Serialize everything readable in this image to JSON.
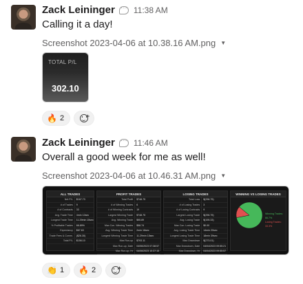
{
  "messages": [
    {
      "author": "Zack Leininger",
      "time": "11:38 AM",
      "text": "Calling it a day!",
      "file_name": "Screenshot 2023-04-06 at 10.38.16 AM.png",
      "thumbnail": {
        "label": "TOTAL P/L",
        "value": "302.10"
      },
      "reactions": [
        {
          "emoji": "🔥",
          "emoji_name": "fire-icon",
          "count": "2"
        }
      ]
    },
    {
      "author": "Zack Leininger",
      "time": "11:46 AM",
      "text": "Overall a good week for me as well!",
      "file_name": "Screenshot 2023-04-06 at 10.46.31 AM.png",
      "dashboard": {
        "panels": [
          {
            "title": "ALL TRADES",
            "rows": [
              [
                "Net P/L",
                "$167.73"
              ],
              [
                "# of Trades",
                "9"
              ],
              [
                "# of Contracts",
                "33"
              ],
              [
                "Avg. Trade Time",
                "4min 12sec"
              ],
              [
                "Longest Trade Time",
                "11.29min 15sec"
              ],
              [
                "% Profitable Trades",
                "66.89%"
              ],
              [
                "Expectancy",
                "$67.63"
              ],
              [
                "Trade Fees & Comm.",
                "($26.30)"
              ],
              [
                "Total P/L",
                "$156.10"
              ]
            ]
          },
          {
            "title": "PROFIT TRADES",
            "rows": [
              [
                "Total Profit",
                "$748.75"
              ],
              [
                "# of Winning Trades",
                "6"
              ],
              [
                "# of Winning Contracts",
                "19"
              ],
              [
                "Largest Winning Trade",
                "$748.75"
              ],
              [
                "Avg. Winning Trade",
                "$95.89"
              ],
              [
                "Max Con. Winning Trades",
                "$58.74"
              ],
              [
                "Avg. Winning Trade Time",
                "2min 16sec"
              ],
              [
                "Longest Winning Trade Time",
                "11.29min 15sec"
              ],
              [
                "Max Run-up",
                "$793.11"
              ],
              [
                "Max Run-up, Date",
                "04/06/2023 07:38:57"
              ],
              [
                "Max Run-up, Hr",
                "04/06/2023 10:37:15"
              ]
            ]
          },
          {
            "title": "LOSING TRADES",
            "rows": [
              [
                "Total Loss",
                "$(296.75)"
              ],
              [
                "# of Losing Trades",
                "3"
              ],
              [
                "# of Losing Contracts",
                "9"
              ],
              [
                "Largest Losing Trade",
                "$(296.75)"
              ],
              [
                "Avg. Losing Trade",
                "$(195.33)"
              ],
              [
                "Max Con. Losing Trade",
                "$0.00"
              ],
              [
                "Avg. Losing Trade Time",
                "14min 20sec"
              ],
              [
                "Longest Losing Trade Time",
                "18min 39sec"
              ],
              [
                "Max Drawdown",
                "$(273.01)"
              ],
              [
                "Max Drawdown, Date",
                "04/04/2023 09:55:21"
              ],
              [
                "Max Drawdown, Hr",
                "04/04/2023 09:55:57"
              ]
            ]
          }
        ],
        "chart_panel_title": "WINNING VS LOSING TRADES",
        "legend": [
          {
            "label": "Winning Trades: 66.7%",
            "color": "#46b85a"
          },
          {
            "label": "Losing Trades: 33.3%",
            "color": "#e05050"
          }
        ]
      },
      "reactions": [
        {
          "emoji": "👏",
          "emoji_name": "clap-icon",
          "count": "1"
        },
        {
          "emoji": "🔥",
          "emoji_name": "fire-icon",
          "count": "2"
        }
      ]
    }
  ],
  "chart_data": {
    "type": "pie",
    "title": "WINNING VS LOSING TRADES",
    "series": [
      {
        "name": "Winning Trades",
        "value": 86,
        "color": "#46b85a"
      },
      {
        "name": "Losing Trades",
        "value": 14,
        "color": "#e05050"
      }
    ]
  }
}
